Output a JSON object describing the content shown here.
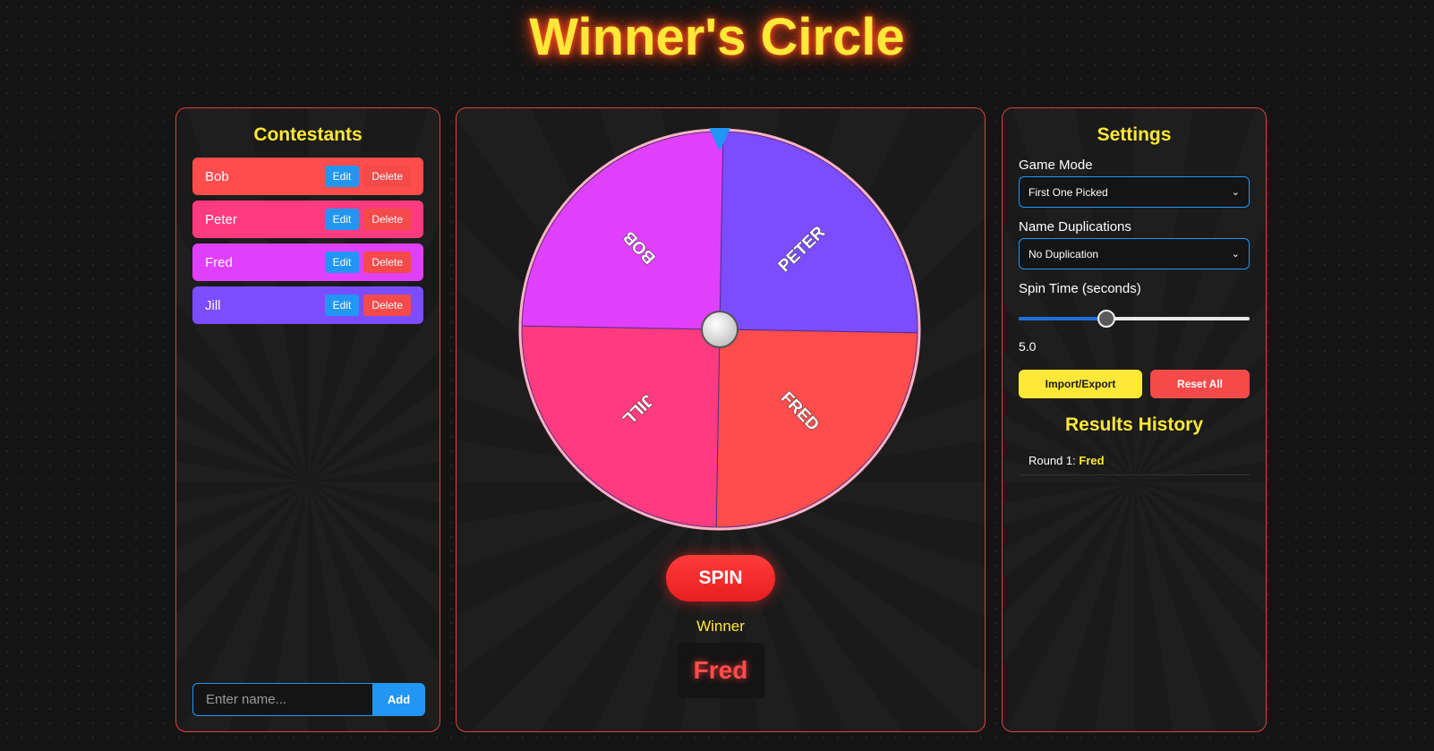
{
  "app": {
    "title": "Winner's Circle"
  },
  "contestants": {
    "heading": "Contestants",
    "items": [
      {
        "name": "Bob",
        "color": "#ff4d4d"
      },
      {
        "name": "Peter",
        "color": "#ff3b7f"
      },
      {
        "name": "Fred",
        "color": "#e040fb"
      },
      {
        "name": "Jill",
        "color": "#7c4dff"
      }
    ],
    "edit_label": "Edit",
    "delete_label": "Delete",
    "input_placeholder": "Enter name...",
    "add_label": "Add"
  },
  "wheel": {
    "segments": [
      {
        "label": "PETER",
        "color": "#7c4dff"
      },
      {
        "label": "FRED",
        "color": "#ff4d4d"
      },
      {
        "label": "JILL",
        "color": "#ff3b7f"
      },
      {
        "label": "BOB",
        "color": "#e040fb"
      }
    ],
    "pointer_icon": "triangle-down-icon",
    "spin_label": "SPIN",
    "winner_label": "Winner",
    "winner_name": "Fred"
  },
  "settings": {
    "heading": "Settings",
    "game_mode_label": "Game Mode",
    "game_mode_value": "First One Picked",
    "duplication_label": "Name Duplications",
    "duplication_value": "No Duplication",
    "spin_time_label": "Spin Time (seconds)",
    "spin_time_value": "5.0",
    "spin_time_fraction": 0.38,
    "import_export_label": "Import/Export",
    "reset_all_label": "Reset All",
    "results_heading": "Results History",
    "history": [
      {
        "round": "Round 1:",
        "winner": "Fred"
      }
    ]
  }
}
